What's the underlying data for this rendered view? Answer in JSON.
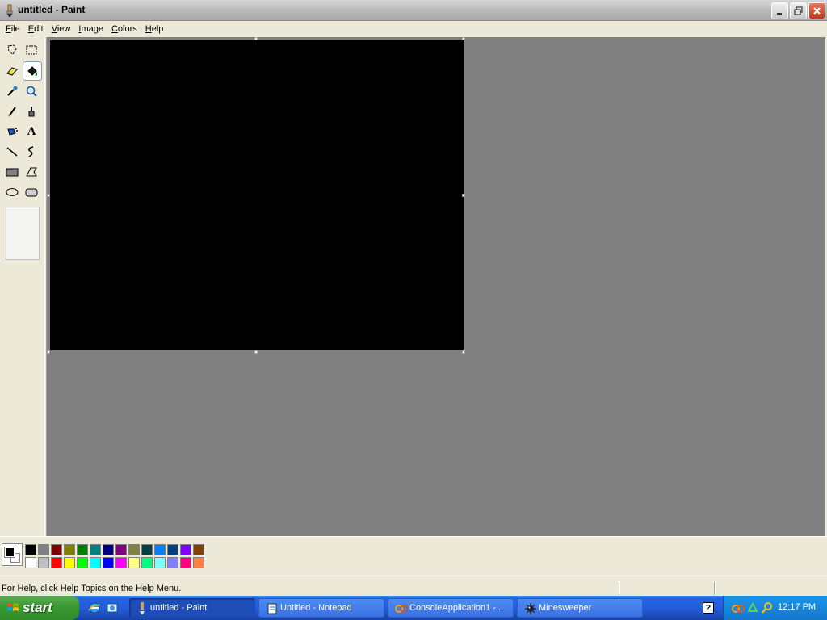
{
  "window": {
    "title": "untitled - Paint"
  },
  "menu": {
    "items": [
      {
        "accel": "F",
        "rest": "ile"
      },
      {
        "accel": "E",
        "rest": "dit"
      },
      {
        "accel": "V",
        "rest": "iew"
      },
      {
        "accel": "I",
        "rest": "mage"
      },
      {
        "accel": "C",
        "rest": "olors"
      },
      {
        "accel": "H",
        "rest": "elp"
      }
    ]
  },
  "toolbox": {
    "tools": [
      "free-form-select-icon",
      "select-icon",
      "eraser-icon",
      "fill-bucket-icon",
      "pick-color-icon",
      "magnifier-icon",
      "pencil-icon",
      "brush-icon",
      "airbrush-icon",
      "text-icon",
      "line-icon",
      "curve-icon",
      "rectangle-icon",
      "polygon-icon",
      "ellipse-icon",
      "rounded-rectangle-icon"
    ],
    "active_tool": "fill-bucket-icon",
    "text_tool_glyph": "A"
  },
  "canvas": {
    "fill_color": "#000000"
  },
  "palette": {
    "foreground": "#000000",
    "background": "#ffffff",
    "row1": [
      "#000000",
      "#808080",
      "#800000",
      "#808000",
      "#008000",
      "#008080",
      "#000080",
      "#800080",
      "#808040",
      "#004040",
      "#0080ff",
      "#004080",
      "#8000ff",
      "#804000"
    ],
    "row2": [
      "#ffffff",
      "#c0c0c0",
      "#ff0000",
      "#ffff00",
      "#00ff00",
      "#00ffff",
      "#0000ff",
      "#ff00ff",
      "#ffff80",
      "#00ff80",
      "#80ffff",
      "#8080ff",
      "#ff0080",
      "#ff8040"
    ]
  },
  "status": {
    "help_text": "For Help, click Help Topics on the Help Menu."
  },
  "taskbar": {
    "start_label": "start",
    "tasks": [
      {
        "label": "untitled - Paint",
        "active": true
      },
      {
        "label": "Untitled - Notepad",
        "active": false
      },
      {
        "label": "ConsoleApplication1 -...",
        "active": false
      },
      {
        "label": "Minesweeper",
        "active": false
      }
    ],
    "clock": "12:17 PM",
    "help_glyph": "?"
  }
}
